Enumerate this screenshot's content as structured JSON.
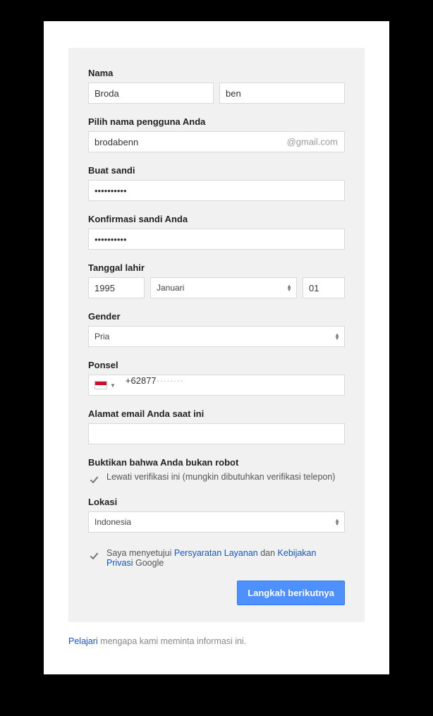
{
  "labels": {
    "name": "Nama",
    "username": "Pilih nama pengguna Anda",
    "password": "Buat sandi",
    "confirm": "Konfirmasi sandi Anda",
    "dob": "Tanggal lahir",
    "gender": "Gender",
    "phone": "Ponsel",
    "currentEmail": "Alamat email Anda saat ini",
    "robot": "Buktikan bahwa Anda bukan robot",
    "location": "Lokasi"
  },
  "values": {
    "firstName": "Broda",
    "lastName": "ben",
    "username": "brodabenn",
    "usernameSuffix": "@gmail.com",
    "password": "••••••••••",
    "confirm": "••••••••••",
    "dobYear": "1995",
    "dobMonth": "Januari",
    "dobDay": "01",
    "gender": "Pria",
    "phonePrefix": "+62877",
    "phoneRest": "········",
    "currentEmail": "",
    "location": "Indonesia"
  },
  "checks": {
    "skipVerify": "Lewati verifikasi ini (mungkin dibutuhkan verifikasi telepon)",
    "agreePrefix": "Saya menyetujui ",
    "termsLink": "Persyaratan Layanan",
    "agreeMid": " dan ",
    "privacyLink": "Kebijakan Privasi",
    "agreeSuffix": " Google"
  },
  "buttons": {
    "submit": "Langkah berikutnya"
  },
  "footer": {
    "linkText": "Pelajari",
    "rest": " mengapa kami meminta informasi ini."
  }
}
